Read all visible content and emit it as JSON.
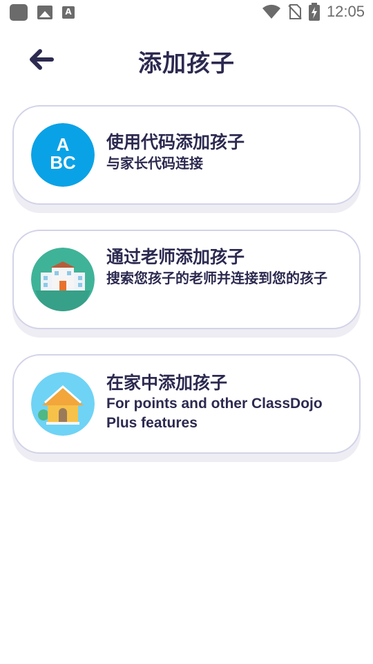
{
  "status_bar": {
    "time": "12:05",
    "icons": [
      "app-icon",
      "gallery-icon",
      "font-icon",
      "wifi-icon",
      "no-sim-icon",
      "battery-charging-icon"
    ]
  },
  "header": {
    "title": "添加孩子",
    "back_icon": "arrow-left-icon"
  },
  "options": [
    {
      "title": "使用代码添加孩子",
      "subtitle": "与家长代码连接",
      "icon": "abc-blocks-icon",
      "icon_color": "#0aa2e6"
    },
    {
      "title": "通过老师添加孩子",
      "subtitle": "搜索您孩子的老师并连接到您的孩子",
      "icon": "school-building-icon",
      "icon_color": "#3fb398"
    },
    {
      "title": "在家中添加孩子",
      "subtitle": "For points and other ClassDojo Plus features",
      "icon": "house-icon",
      "icon_color": "#6fd3f5"
    }
  ],
  "colors": {
    "text": "#2c2a50",
    "card_border": "#d2d3e8",
    "card_shadow": "#ededf3"
  }
}
